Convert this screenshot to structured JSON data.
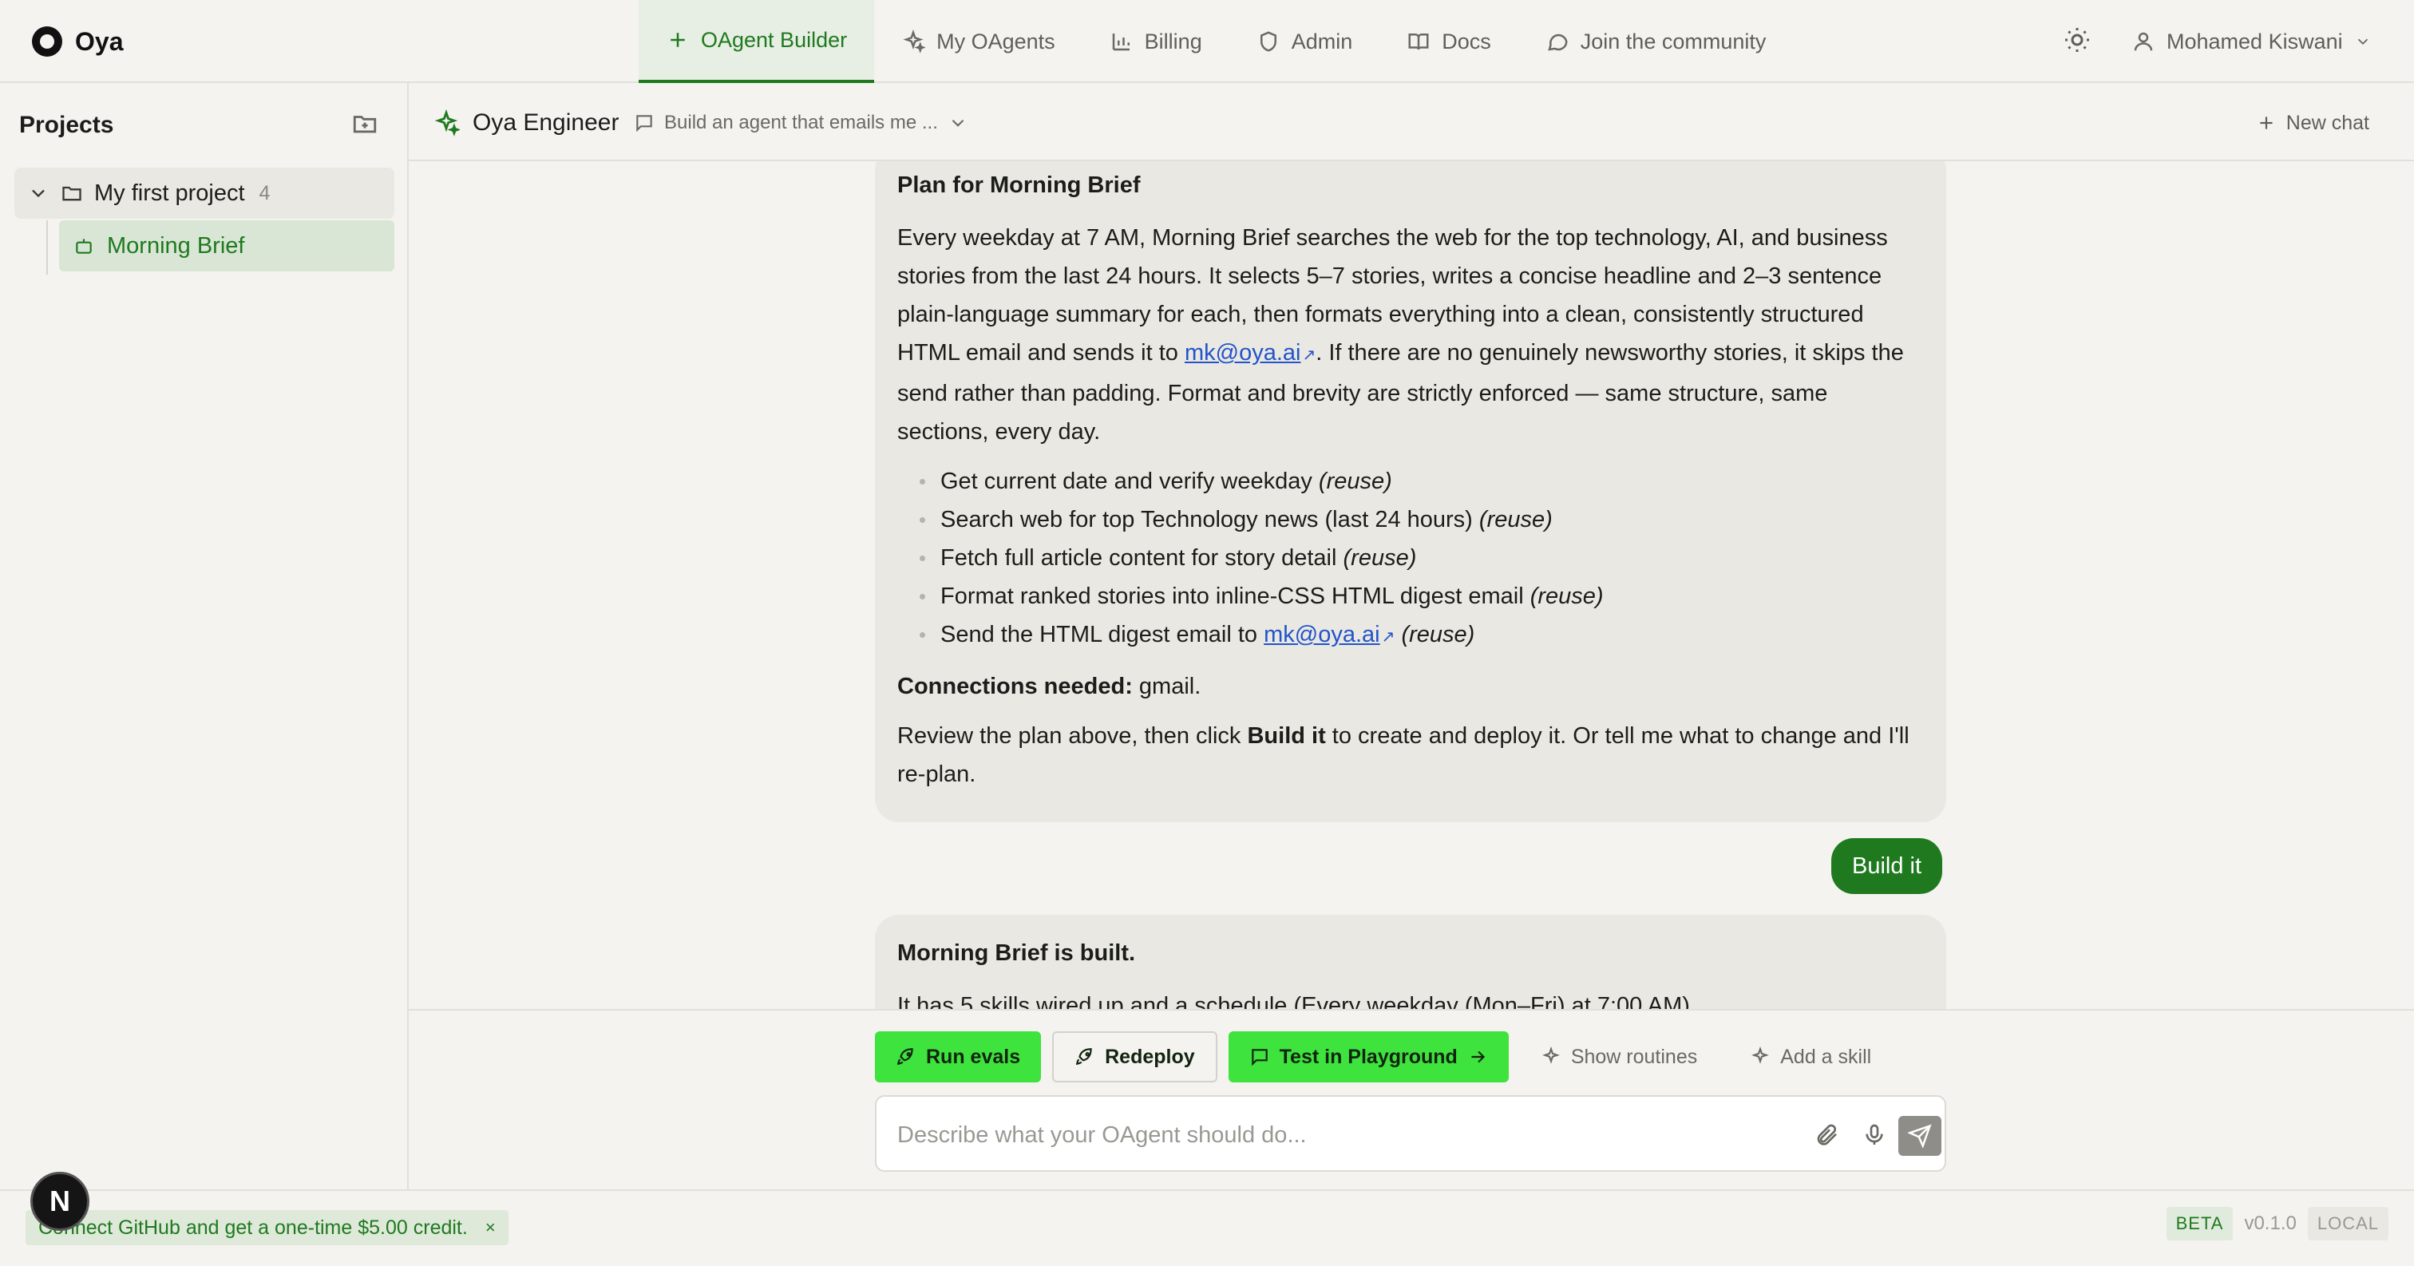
{
  "app": {
    "name": "Oya"
  },
  "nav": {
    "tabs": [
      {
        "label": "OAgent Builder",
        "icon": "plus-icon",
        "active": true
      },
      {
        "label": "My OAgents",
        "icon": "sparkle-icon"
      },
      {
        "label": "Billing",
        "icon": "bar-chart-icon"
      },
      {
        "label": "Admin",
        "icon": "shield-icon"
      },
      {
        "label": "Docs",
        "icon": "book-icon"
      },
      {
        "label": "Join the community",
        "icon": "chat-bubble-icon"
      }
    ],
    "user": "Mohamed Kiswani"
  },
  "sidebar": {
    "title": "Projects",
    "project": {
      "name": "My first project",
      "count": "4"
    },
    "agent": {
      "name": "Morning Brief"
    }
  },
  "chat": {
    "agent_name": "Oya Engineer",
    "title": "Build an agent that emails me ...",
    "new_chat": "New chat"
  },
  "messages": {
    "plan": {
      "heading": "Plan for Morning Brief",
      "para_before_link": "Every weekday at 7 AM, Morning Brief searches the web for the top technology, AI, and business stories from the last 24 hours. It selects 5–7 stories, writes a concise headline and 2–3 sentence plain-language summary for each, then formats everything into a clean, consistently structured HTML email and sends it to ",
      "email": "mk@oya.ai",
      "para_after_link": ". If there are no genuinely newsworthy stories, it skips the send rather than padding. Format and brevity are strictly enforced — same structure, same sections, every day.",
      "steps": [
        {
          "text": "Get current date and verify weekday",
          "tag": "(reuse)"
        },
        {
          "text": "Search web for top Technology news (last 24 hours)",
          "tag": "(reuse)"
        },
        {
          "text": "Fetch full article content for story detail",
          "tag": "(reuse)"
        },
        {
          "text": "Format ranked stories into inline-CSS HTML digest email",
          "tag": "(reuse)"
        },
        {
          "text": "Send the HTML digest email to",
          "link": "mk@oya.ai",
          "tag": "(reuse)"
        }
      ],
      "connections_label": "Connections needed:",
      "connections_value": " gmail.",
      "review_before": "Review the plan above, then click ",
      "review_bold": "Build it",
      "review_after": " to create and deploy it. Or tell me what to change and I'll re-plan."
    },
    "user_reply": "Build it",
    "built": {
      "heading": "Morning Brief is built.",
      "text": "It has 5 skills wired up and a schedule (Every weekday (Mon–Fri) at 7:00 AM)."
    }
  },
  "actions": {
    "run_evals": "Run evals",
    "redeploy": "Redeploy",
    "test_playground": "Test in Playground",
    "show_routines": "Show routines",
    "add_skill": "Add a skill"
  },
  "composer": {
    "placeholder": "Describe what your OAgent should do..."
  },
  "footer": {
    "promo": "Connect GitHub and get a one-time $5.00 credit.",
    "promo_close": "×",
    "avatar_letter": "N",
    "beta": "BETA",
    "version": "v0.1.0",
    "env": "LOCAL"
  },
  "colors": {
    "accent": "#1f7a1f",
    "accent_bright": "#3ee33e",
    "background": "#f4f3ef",
    "bubble": "#e9e8e3",
    "link": "#2354c8"
  }
}
